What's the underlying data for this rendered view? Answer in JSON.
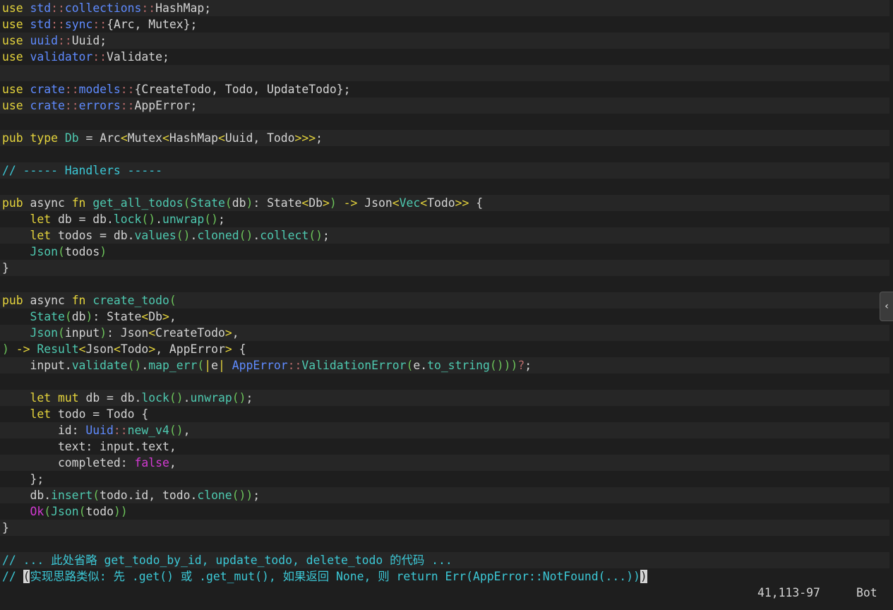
{
  "colors": {
    "background": "#1e1e1e",
    "alt_line": "#262626",
    "keyword": "#e5d43c",
    "module": "#5f8bff",
    "path_sep": "#b66a6a",
    "function": "#4ec9b0",
    "type": "#d4d4d4",
    "comment": "#3cc8d6",
    "bool": "#d33ad3",
    "paren": "#6cc45a",
    "bracket": "#e5d43c",
    "default": "#d4d4d4"
  },
  "lines": [
    [
      [
        "kw",
        "use"
      ],
      [
        "t",
        " "
      ],
      [
        "mod",
        "std"
      ],
      [
        "sep",
        "::"
      ],
      [
        "mod",
        "collections"
      ],
      [
        "sep",
        "::"
      ],
      [
        "t",
        "HashMap;"
      ]
    ],
    [
      [
        "kw",
        "use"
      ],
      [
        "t",
        " "
      ],
      [
        "mod",
        "std"
      ],
      [
        "sep",
        "::"
      ],
      [
        "mod",
        "sync"
      ],
      [
        "sep",
        "::"
      ],
      [
        "t",
        "{Arc, Mutex};"
      ]
    ],
    [
      [
        "kw",
        "use"
      ],
      [
        "t",
        " "
      ],
      [
        "mod",
        "uuid"
      ],
      [
        "sep",
        "::"
      ],
      [
        "t",
        "Uuid;"
      ]
    ],
    [
      [
        "kw",
        "use"
      ],
      [
        "t",
        " "
      ],
      [
        "mod",
        "validator"
      ],
      [
        "sep",
        "::"
      ],
      [
        "t",
        "Validate;"
      ]
    ],
    [],
    [
      [
        "kw",
        "use"
      ],
      [
        "t",
        " "
      ],
      [
        "mod",
        "crate"
      ],
      [
        "sep",
        "::"
      ],
      [
        "mod",
        "models"
      ],
      [
        "sep",
        "::"
      ],
      [
        "t",
        "{CreateTodo, Todo, UpdateTodo};"
      ]
    ],
    [
      [
        "kw",
        "use"
      ],
      [
        "t",
        " "
      ],
      [
        "mod",
        "crate"
      ],
      [
        "sep",
        "::"
      ],
      [
        "mod",
        "errors"
      ],
      [
        "sep",
        "::"
      ],
      [
        "t",
        "AppError;"
      ]
    ],
    [],
    [
      [
        "kw",
        "pub"
      ],
      [
        "t",
        " "
      ],
      [
        "kw",
        "type"
      ],
      [
        "t",
        " "
      ],
      [
        "fn",
        "Db"
      ],
      [
        "t",
        " = Arc"
      ],
      [
        "br",
        "<"
      ],
      [
        "t",
        "Mutex"
      ],
      [
        "br",
        "<"
      ],
      [
        "t",
        "HashMap"
      ],
      [
        "br",
        "<"
      ],
      [
        "t",
        "Uuid, Todo"
      ],
      [
        "br",
        ">>>"
      ],
      [
        "t",
        ";"
      ]
    ],
    [],
    [
      [
        "cm",
        "// ----- Handlers -----"
      ]
    ],
    [],
    [
      [
        "kw",
        "pub"
      ],
      [
        "t",
        " async "
      ],
      [
        "kw",
        "fn"
      ],
      [
        "t",
        " "
      ],
      [
        "fn",
        "get_all_todos"
      ],
      [
        "p",
        "("
      ],
      [
        "fn",
        "State"
      ],
      [
        "p",
        "("
      ],
      [
        "t",
        "db"
      ],
      [
        "p",
        ")"
      ],
      [
        "t",
        ": State"
      ],
      [
        "br",
        "<"
      ],
      [
        "t",
        "Db"
      ],
      [
        "br",
        ">"
      ],
      [
        "p",
        ")"
      ],
      [
        "t",
        " "
      ],
      [
        "kw",
        "->"
      ],
      [
        "t",
        " Json"
      ],
      [
        "br",
        "<"
      ],
      [
        "fn",
        "Vec"
      ],
      [
        "br",
        "<"
      ],
      [
        "t",
        "Todo"
      ],
      [
        "br",
        ">>"
      ],
      [
        "t",
        " {"
      ]
    ],
    [
      [
        "t",
        "    "
      ],
      [
        "kw",
        "let"
      ],
      [
        "t",
        " db = db."
      ],
      [
        "fn",
        "lock"
      ],
      [
        "p",
        "()"
      ],
      [
        "t",
        "."
      ],
      [
        "fn",
        "unwrap"
      ],
      [
        "p",
        "()"
      ],
      [
        "t",
        ";"
      ]
    ],
    [
      [
        "t",
        "    "
      ],
      [
        "kw",
        "let"
      ],
      [
        "t",
        " todos = db."
      ],
      [
        "fn",
        "values"
      ],
      [
        "p",
        "()"
      ],
      [
        "t",
        "."
      ],
      [
        "fn",
        "cloned"
      ],
      [
        "p",
        "()"
      ],
      [
        "t",
        "."
      ],
      [
        "fn",
        "collect"
      ],
      [
        "p",
        "()"
      ],
      [
        "t",
        ";"
      ]
    ],
    [
      [
        "t",
        "    "
      ],
      [
        "fn",
        "Json"
      ],
      [
        "p",
        "("
      ],
      [
        "t",
        "todos"
      ],
      [
        "p",
        ")"
      ]
    ],
    [
      [
        "t",
        "}"
      ]
    ],
    [],
    [
      [
        "kw",
        "pub"
      ],
      [
        "t",
        " async "
      ],
      [
        "kw",
        "fn"
      ],
      [
        "t",
        " "
      ],
      [
        "fn",
        "create_todo"
      ],
      [
        "p",
        "("
      ]
    ],
    [
      [
        "t",
        "    "
      ],
      [
        "fn",
        "State"
      ],
      [
        "p",
        "("
      ],
      [
        "t",
        "db"
      ],
      [
        "p",
        ")"
      ],
      [
        "t",
        ": State"
      ],
      [
        "br",
        "<"
      ],
      [
        "t",
        "Db"
      ],
      [
        "br",
        ">"
      ],
      [
        "t",
        ","
      ]
    ],
    [
      [
        "t",
        "    "
      ],
      [
        "fn",
        "Json"
      ],
      [
        "p",
        "("
      ],
      [
        "t",
        "input"
      ],
      [
        "p",
        ")"
      ],
      [
        "t",
        ": Json"
      ],
      [
        "br",
        "<"
      ],
      [
        "t",
        "CreateTodo"
      ],
      [
        "br",
        ">"
      ],
      [
        "t",
        ","
      ]
    ],
    [
      [
        "p",
        ")"
      ],
      [
        "t",
        " "
      ],
      [
        "kw",
        "->"
      ],
      [
        "t",
        " "
      ],
      [
        "fn",
        "Result"
      ],
      [
        "br",
        "<"
      ],
      [
        "t",
        "Json"
      ],
      [
        "br",
        "<"
      ],
      [
        "t",
        "Todo"
      ],
      [
        "br",
        ">"
      ],
      [
        "t",
        ", AppError"
      ],
      [
        "br",
        ">"
      ],
      [
        "t",
        " {"
      ]
    ],
    [
      [
        "t",
        "    input."
      ],
      [
        "fn",
        "validate"
      ],
      [
        "p",
        "()"
      ],
      [
        "t",
        "."
      ],
      [
        "fn",
        "map_err"
      ],
      [
        "p",
        "("
      ],
      [
        "br",
        "|"
      ],
      [
        "t",
        "e"
      ],
      [
        "br",
        "|"
      ],
      [
        "t",
        " "
      ],
      [
        "mod",
        "AppError"
      ],
      [
        "sep",
        "::"
      ],
      [
        "fn",
        "ValidationError"
      ],
      [
        "p",
        "("
      ],
      [
        "t",
        "e."
      ],
      [
        "fn",
        "to_string"
      ],
      [
        "p",
        "()))"
      ],
      [
        "kw2",
        "?"
      ],
      [
        "t",
        ";"
      ]
    ],
    [],
    [
      [
        "t",
        "    "
      ],
      [
        "kw",
        "let"
      ],
      [
        "t",
        " "
      ],
      [
        "kw",
        "mut"
      ],
      [
        "t",
        " db = db."
      ],
      [
        "fn",
        "lock"
      ],
      [
        "p",
        "()"
      ],
      [
        "t",
        "."
      ],
      [
        "fn",
        "unwrap"
      ],
      [
        "p",
        "()"
      ],
      [
        "t",
        ";"
      ]
    ],
    [
      [
        "t",
        "    "
      ],
      [
        "kw",
        "let"
      ],
      [
        "t",
        " todo = Todo {"
      ]
    ],
    [
      [
        "t",
        "        id: "
      ],
      [
        "mod",
        "Uuid"
      ],
      [
        "sep",
        "::"
      ],
      [
        "fn",
        "new_v4"
      ],
      [
        "p",
        "()"
      ],
      [
        "t",
        ","
      ]
    ],
    [
      [
        "t",
        "        text: input.text,"
      ]
    ],
    [
      [
        "t",
        "        completed: "
      ],
      [
        "bool",
        "false"
      ],
      [
        "t",
        ","
      ]
    ],
    [
      [
        "t",
        "    };"
      ]
    ],
    [
      [
        "t",
        "    db."
      ],
      [
        "fn",
        "insert"
      ],
      [
        "p",
        "("
      ],
      [
        "t",
        "todo.id, todo."
      ],
      [
        "fn",
        "clone"
      ],
      [
        "p",
        "())"
      ],
      [
        "t",
        ";"
      ]
    ],
    [
      [
        "t",
        "    "
      ],
      [
        "bool",
        "Ok"
      ],
      [
        "p",
        "("
      ],
      [
        "fn",
        "Json"
      ],
      [
        "p",
        "("
      ],
      [
        "t",
        "todo"
      ],
      [
        "p",
        "))"
      ]
    ],
    [
      [
        "t",
        "}"
      ]
    ],
    [],
    [
      [
        "cm",
        "// ... 此处省略 get_todo_by_id, update_todo, delete_todo 的代码 ..."
      ]
    ],
    [
      [
        "cm",
        "// "
      ],
      [
        "cur",
        "("
      ],
      [
        "cm",
        "实现思路类似: 先 .get() 或 .get_mut(), 如果返回 None, 则 return Err(AppError::NotFound(...))"
      ],
      [
        "cur",
        ")"
      ]
    ]
  ],
  "status": {
    "ruler": "41,113-97",
    "scroll_position": "Bot"
  },
  "collapse_icon": "chevron-left-icon",
  "collapse_glyph": "‹"
}
